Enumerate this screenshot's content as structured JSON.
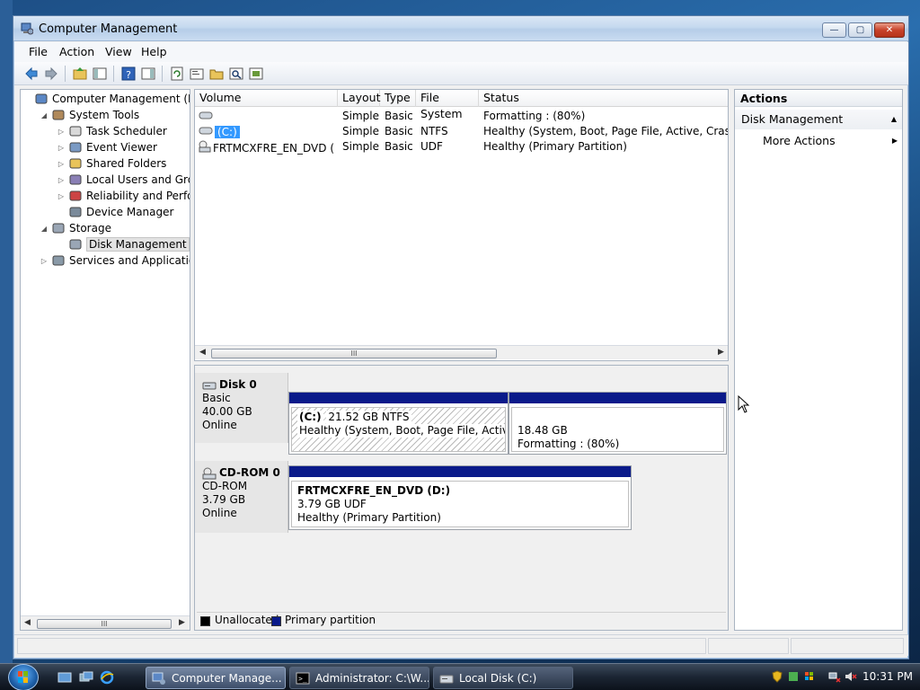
{
  "window": {
    "title": "Computer Management",
    "buttons": {
      "minimize": "—",
      "maximize": "▢",
      "close": "✕"
    }
  },
  "menu": [
    "File",
    "Action",
    "View",
    "Help"
  ],
  "toolbar": [
    "back-icon",
    "forward-icon",
    "up-icon",
    "show-hide-tree-icon",
    "help-icon",
    "show-hide-action-icon",
    "refresh-icon",
    "properties-icon",
    "open-icon",
    "search-icon",
    "settings-icon"
  ],
  "tree": {
    "items": [
      {
        "label": "Computer Management (Local",
        "icon": "computer-icon",
        "indent": 0,
        "twisty": ""
      },
      {
        "label": "System Tools",
        "icon": "tools-icon",
        "indent": 1,
        "twisty": "◢"
      },
      {
        "label": "Task Scheduler",
        "icon": "clock-icon",
        "indent": 2,
        "twisty": "▷"
      },
      {
        "label": "Event Viewer",
        "icon": "event-viewer-icon",
        "indent": 2,
        "twisty": "▷"
      },
      {
        "label": "Shared Folders",
        "icon": "shared-folder-icon",
        "indent": 2,
        "twisty": "▷"
      },
      {
        "label": "Local Users and Groups",
        "icon": "users-icon",
        "indent": 2,
        "twisty": "▷"
      },
      {
        "label": "Reliability and Performa",
        "icon": "performance-icon",
        "indent": 2,
        "twisty": "▷"
      },
      {
        "label": "Device Manager",
        "icon": "device-manager-icon",
        "indent": 2,
        "twisty": ""
      },
      {
        "label": "Storage",
        "icon": "storage-icon",
        "indent": 1,
        "twisty": "◢"
      },
      {
        "label": "Disk Management",
        "icon": "disk-icon",
        "indent": 2,
        "twisty": "",
        "selected": true
      },
      {
        "label": "Services and Applications",
        "icon": "services-icon",
        "indent": 1,
        "twisty": "▷"
      }
    ],
    "scroll_thumb": "III"
  },
  "volumes": {
    "columns": [
      "Volume",
      "Layout",
      "Type",
      "File System",
      "Status"
    ],
    "rows": [
      {
        "volume": "",
        "icon": "volume-icon",
        "layout": "Simple",
        "type": "Basic",
        "fs": "",
        "status": "Formatting : (80%)"
      },
      {
        "volume": "(C:)",
        "icon": "volume-icon",
        "layout": "Simple",
        "type": "Basic",
        "fs": "NTFS",
        "status": "Healthy (System, Boot, Page File, Active, Crash Dum",
        "selected": true
      },
      {
        "volume": "FRTMCXFRE_EN_DVD (D:)",
        "icon": "cdrom-icon",
        "layout": "Simple",
        "type": "Basic",
        "fs": "UDF",
        "status": "Healthy (Primary Partition)"
      }
    ],
    "scroll_thumb": "III"
  },
  "disks": [
    {
      "name": "Disk 0",
      "type": "Basic",
      "size": "40.00 GB",
      "state": "Online",
      "partitions": [
        {
          "title": "(C:)",
          "size": "21.52 GB NTFS",
          "status": "Healthy (System, Boot, Page File, Active, Cr"
        },
        {
          "title": "",
          "size": "18.48 GB",
          "status": "Formatting : (80%)"
        }
      ]
    },
    {
      "name": "CD-ROM 0",
      "type": "CD-ROM",
      "size": "3.79 GB",
      "state": "Online",
      "partitions": [
        {
          "title": "FRTMCXFRE_EN_DVD  (D:)",
          "size": "3.79 GB UDF",
          "status": "Healthy (Primary Partition)"
        }
      ]
    }
  ],
  "legend": {
    "unallocated": "Unallocated",
    "primary": "Primary partition",
    "unallocated_color": "#000000",
    "primary_color": "#0a1a8a"
  },
  "actions": {
    "header": "Actions",
    "section": "Disk Management",
    "section_arrow": "▲",
    "more": "More Actions",
    "more_arrow": "▶"
  },
  "taskbar": {
    "tasks": [
      {
        "label": "Computer Manage...",
        "active": true
      },
      {
        "label": "Administrator: C:\\W...",
        "active": false
      },
      {
        "label": "Local Disk (C:)",
        "active": false
      }
    ],
    "clock": "10:31 PM"
  },
  "colors": {
    "selection": "#3399ff",
    "partition_bar": "#0a1a8a"
  }
}
